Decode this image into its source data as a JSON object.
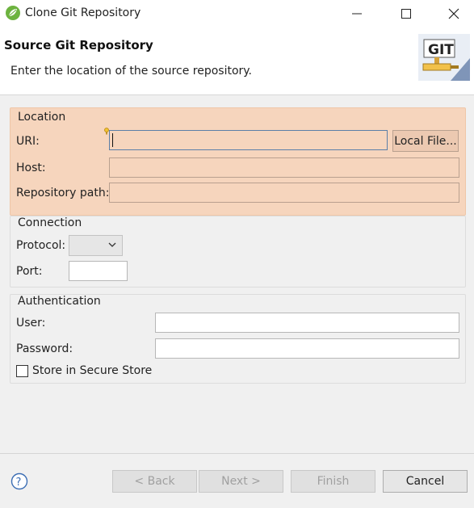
{
  "window": {
    "title": "Clone Git Repository",
    "minimize_icon": "minimize-icon",
    "maximize_icon": "maximize-icon",
    "close_icon": "close-icon"
  },
  "header": {
    "title": "Source Git Repository",
    "description": "Enter the location of the source repository.",
    "logo_text": "GIT"
  },
  "location": {
    "group_label": "Location",
    "uri_label": "URI:",
    "uri_value": "",
    "local_file_button": "Local File...",
    "host_label": "Host:",
    "host_value": "",
    "repo_path_label": "Repository path:",
    "repo_path_value": ""
  },
  "connection": {
    "group_label": "Connection",
    "protocol_label": "Protocol:",
    "protocol_value": "",
    "port_label": "Port:",
    "port_value": ""
  },
  "authentication": {
    "group_label": "Authentication",
    "user_label": "User:",
    "user_value": "",
    "password_label": "Password:",
    "password_value": "",
    "store_label": "Store in Secure Store",
    "store_checked": false
  },
  "footer": {
    "back_button": "< Back",
    "next_button": "Next >",
    "finish_button": "Finish",
    "cancel_button": "Cancel"
  },
  "colors": {
    "highlight_bg": "#f6d5bd",
    "focus_border": "#5b7fa8",
    "app_icon_green": "#6db33f"
  }
}
